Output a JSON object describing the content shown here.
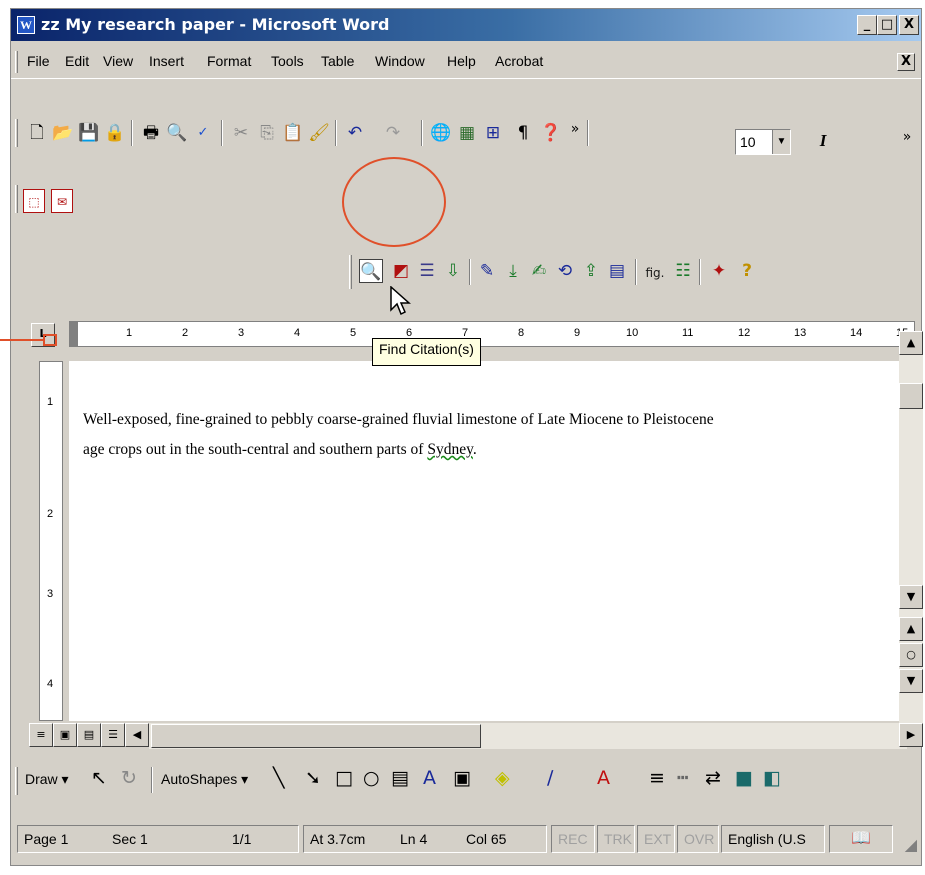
{
  "window": {
    "title": "zz My research paper - Microsoft Word",
    "app_icon": "W"
  },
  "caption_buttons": {
    "minimize": "_",
    "maximize": "□",
    "close": "X"
  },
  "menu": {
    "items": [
      "File",
      "Edit",
      "View",
      "Insert",
      "Format",
      "Tools",
      "Table",
      "Window",
      "Help",
      "Acrobat"
    ],
    "close": "X"
  },
  "standard_toolbar": {
    "font_size": "10",
    "italic": "I",
    "overflow": "»",
    "pilcrow": "¶",
    "icons": [
      "new-icon",
      "open-icon",
      "save-icon",
      "permission-icon",
      "print-icon",
      "print-preview-icon",
      "spelling-icon",
      "cut-icon",
      "copy-icon",
      "paste-icon",
      "format-painter-icon",
      "undo-icon",
      "redo-icon",
      "hyperlink-icon",
      "tables-borders-icon",
      "insert-table-icon",
      "show-hide-icon",
      "help-icon"
    ]
  },
  "acrobat_toolbar": {
    "icons": [
      "convert-to-pdf-icon",
      "convert-and-email-icon"
    ]
  },
  "citation_toolbar": {
    "fig_label": "fig.",
    "help": "?",
    "icons": [
      "find-citation-icon",
      "insert-reference-icon",
      "bibliography-icon",
      "go-to-icon",
      "edit-icon",
      "insert-icon",
      "manuscript-icon",
      "preferences-icon",
      "unformat-icon",
      "generate-icon",
      "figure-icon",
      "list-icon",
      "tools-icon",
      "help-icon"
    ]
  },
  "tooltip": {
    "text": "Find Citation(s)"
  },
  "ruler": {
    "numbers": [
      "1",
      "2",
      "3",
      "4",
      "5",
      "6",
      "7",
      "8",
      "9",
      "10",
      "11",
      "12",
      "13",
      "14",
      "15"
    ],
    "tab_selector": "L"
  },
  "vertical_ruler": {
    "numbers": [
      "1",
      "2",
      "3",
      "4"
    ]
  },
  "document": {
    "line1": "Well-exposed, fine-grained to pebbly coarse-grained fluvial limestone of Late Miocene to Pleistocene",
    "line2_prefix": "age crops out in the south-central and southern parts of ",
    "line2_word": "Sydney",
    "line2_suffix": "."
  },
  "drawing_toolbar": {
    "draw": "Draw",
    "autoshapes": "AutoShapes"
  },
  "status_bar": {
    "page": "Page 1",
    "sec": "Sec 1",
    "pages": "1/1",
    "at": "At 3.7cm",
    "ln": "Ln 4",
    "col": "Col 65",
    "rec": "REC",
    "trk": "TRK",
    "ext": "EXT",
    "ovr": "OVR",
    "language": "English (U.S"
  },
  "colors": {
    "title_gradient_start": "#0a246a",
    "title_gradient_end": "#a6caf0",
    "chrome": "#d4d0c8",
    "annotation": "#e0502a"
  }
}
